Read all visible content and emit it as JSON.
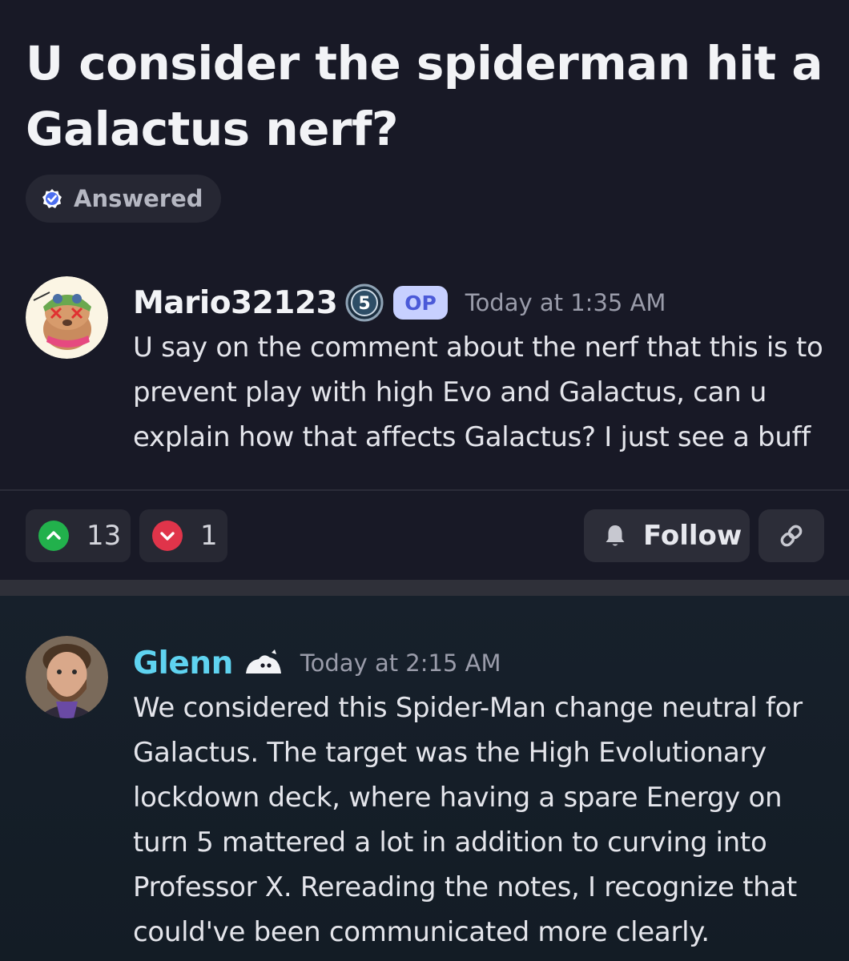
{
  "thread": {
    "title": "U consider the spiderman hit a Galactus nerf?",
    "status_label": "Answered"
  },
  "original_post": {
    "author": "Mario32123",
    "level": "5",
    "op_label": "OP",
    "timestamp": "Today at 1:35 AM",
    "body": "U say on the comment about the nerf that this is to prevent play with high Evo and Galactus, can u explain how that affects Galactus? I just see a buff"
  },
  "actions": {
    "upvotes": "13",
    "downvotes": "1",
    "follow_label": "Follow"
  },
  "reply": {
    "author": "Glenn",
    "timestamp": "Today at 2:15 AM",
    "body": "We considered this Spider-Man change neutral for Galactus. The target was the High Evolutionary lockdown deck, where having a spare Energy on turn 5 mattered a lot in addition to curving into Professor X. Rereading the notes, I recognize that could've been communicated more clearly."
  },
  "icons": {
    "answered": "check-circle-icon",
    "upvote": "chevron-up-icon",
    "downvote": "chevron-down-icon",
    "follow": "bell-icon",
    "link": "link-icon",
    "author_badge": "ghost-badge-icon"
  },
  "colors": {
    "background": "#181926",
    "upvote": "#22b14c",
    "downvote": "#e0344a",
    "op_badge_bg": "#c7d0ff",
    "op_badge_text": "#4b5ad8",
    "staff_name": "#5fd3f0"
  }
}
